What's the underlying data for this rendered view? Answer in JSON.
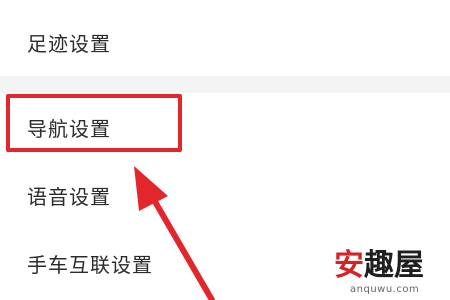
{
  "settings": {
    "items": [
      {
        "label": "足迹设置"
      },
      {
        "label": "导航设置"
      },
      {
        "label": "语音设置"
      },
      {
        "label": "手车互联设置"
      }
    ]
  },
  "annotation": {
    "highlight_color": "#e3262c",
    "arrow_color": "#e3262c"
  },
  "watermark": {
    "logo_chars": [
      "安",
      "趣",
      "屋"
    ],
    "domain": "anquwu.com"
  }
}
